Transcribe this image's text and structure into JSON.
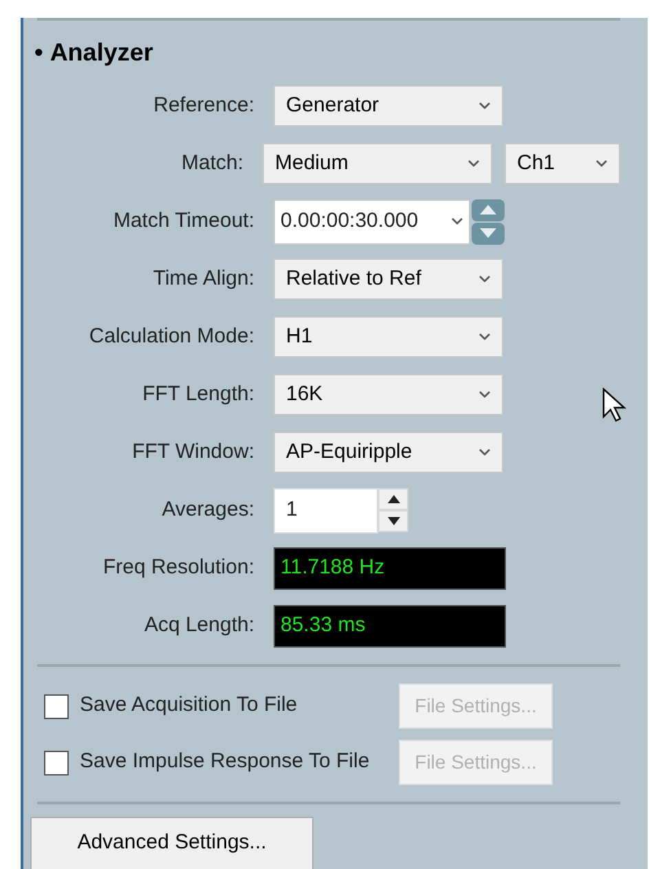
{
  "section": {
    "bullet": "•",
    "title": "Analyzer"
  },
  "fields": [
    {
      "kind": "dropdown",
      "label": "Reference:",
      "value": "Generator"
    },
    {
      "kind": "dropdown",
      "label": "Match:",
      "value": "Medium",
      "extra": {
        "value": "Ch1"
      }
    },
    {
      "kind": "time",
      "label": "Match Timeout:",
      "value": "0.00:00:30.000"
    },
    {
      "kind": "dropdown",
      "label": "Time Align:",
      "value": "Relative to Ref"
    },
    {
      "kind": "dropdown",
      "label": "Calculation Mode:",
      "value": "H1"
    },
    {
      "kind": "dropdown",
      "label": "FFT Length:",
      "value": "16K"
    },
    {
      "kind": "dropdown",
      "label": "FFT Window:",
      "value": "AP-Equiripple"
    },
    {
      "kind": "spinner",
      "label": "Averages:",
      "value": "1"
    },
    {
      "kind": "readout",
      "label": "Freq Resolution:",
      "value": "11.7188 Hz"
    },
    {
      "kind": "readout",
      "label": "Acq Length:",
      "value": "85.33 ms"
    }
  ],
  "options": [
    {
      "label": "Save Acquisition To File",
      "checked": false,
      "button": {
        "label": "File Settings...",
        "disabled": true
      }
    },
    {
      "label": "Save Impulse Response To File",
      "checked": false,
      "button": {
        "label": "File Settings...",
        "disabled": true
      }
    }
  ],
  "advanced_button": {
    "label": "Advanced Settings..."
  }
}
